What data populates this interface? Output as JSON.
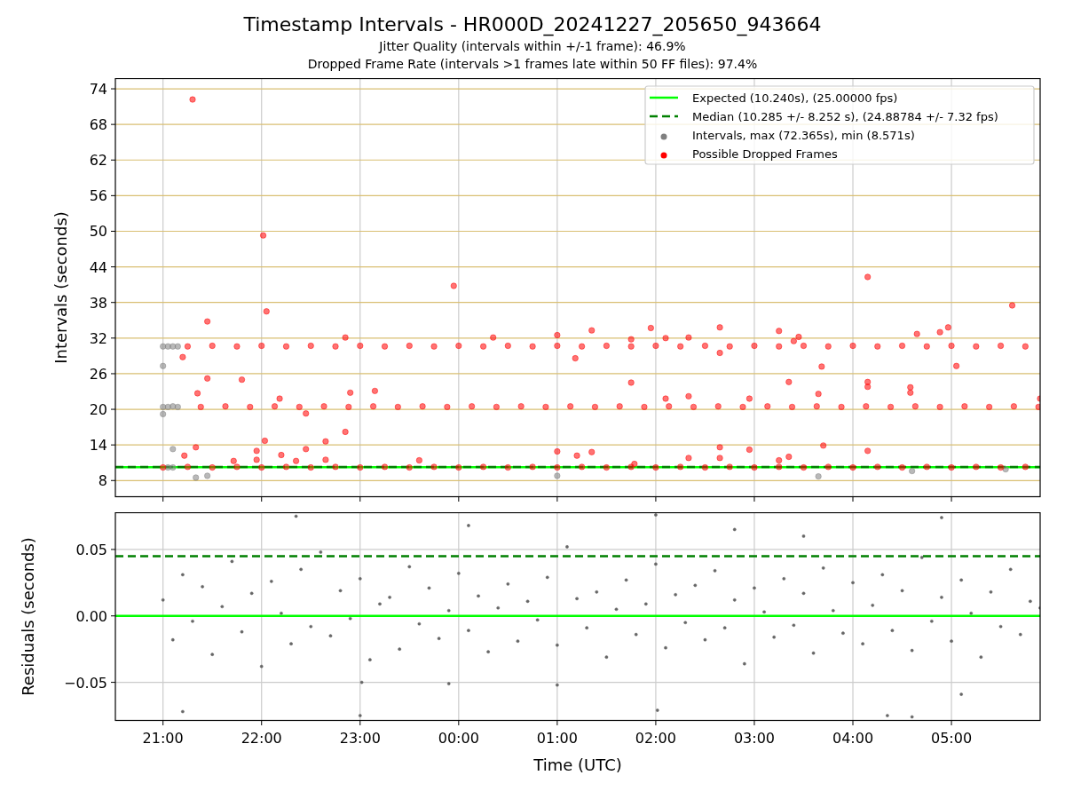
{
  "title": "Timestamp Intervals - HR000D_20241227_205650_943664",
  "subtitles": [
    "Jitter Quality (intervals within +/-1 frame): 46.9%",
    "Dropped Frame Rate (intervals >1 frames late within 50 FF files): 97.4%"
  ],
  "charts": [
    {
      "chart_data": {
        "type": "scatter",
        "ylabel": "Intervals (seconds)",
        "xlim": [
          "2024-12-27T20:31",
          "2024-12-28T05:54"
        ],
        "ylim": [
          5.2,
          75.8
        ],
        "yticks": [
          8,
          14,
          20,
          26,
          32,
          38,
          44,
          50,
          56,
          62,
          68,
          74
        ],
        "grid": true,
        "legend": true,
        "ref_lines": [
          {
            "label": "Expected (10.240s), (25.00000 fps)",
            "color": "#00ff00",
            "axis": "y",
            "value": 10.24
          },
          {
            "label": "Median (10.285 +/- 8.252 s), (24.88784 +/- 7.32 fps)",
            "color": "#008000",
            "axis": "y",
            "value": 10.285
          }
        ],
        "series": [
          {
            "name": "Intervals, max (72.365s), min (8.571s)",
            "color": "#808080",
            "x": [
              "2024-12-27T21:00",
              "2024-12-27T21:03",
              "2024-12-27T21:06",
              "2024-12-27T21:09",
              "2024-12-27T21:00",
              "2024-12-27T21:03",
              "2024-12-27T21:06",
              "2024-12-27T21:09",
              "2024-12-27T21:03",
              "2024-12-27T21:06",
              "2024-12-27T21:00",
              "2024-12-27T21:00",
              "2024-12-27T21:06",
              "2024-12-27T21:20",
              "2024-12-27T21:27",
              "2024-12-28T01:00",
              "2024-12-28T03:39",
              "2024-12-28T04:36",
              "2024-12-28T05:33"
            ],
            "values": [
              30.6,
              30.6,
              30.6,
              30.6,
              20.4,
              20.4,
              20.5,
              20.4,
              10.2,
              10.2,
              27.3,
              19.2,
              13.3,
              8.5,
              8.8,
              8.8,
              8.7,
              9.6,
              9.9
            ]
          },
          {
            "name": "Possible Dropped Frames",
            "color": "#ff0000",
            "x": [
              "2024-12-27T21:00",
              "2024-12-27T21:15",
              "2024-12-27T21:30",
              "2024-12-27T21:45",
              "2024-12-27T22:00",
              "2024-12-27T22:15",
              "2024-12-27T22:30",
              "2024-12-27T22:45",
              "2024-12-27T23:00",
              "2024-12-27T23:15",
              "2024-12-27T23:30",
              "2024-12-27T23:45",
              "2024-12-28T00:00",
              "2024-12-28T00:15",
              "2024-12-28T00:30",
              "2024-12-28T00:45",
              "2024-12-28T01:00",
              "2024-12-28T01:15",
              "2024-12-28T01:30",
              "2024-12-28T01:45",
              "2024-12-28T02:00",
              "2024-12-28T02:15",
              "2024-12-28T02:30",
              "2024-12-28T02:45",
              "2024-12-28T03:00",
              "2024-12-28T03:15",
              "2024-12-28T03:30",
              "2024-12-28T03:45",
              "2024-12-28T04:00",
              "2024-12-28T04:15",
              "2024-12-28T04:30",
              "2024-12-28T04:45",
              "2024-12-28T05:00",
              "2024-12-28T05:15",
              "2024-12-28T05:30",
              "2024-12-28T05:45",
              "2024-12-27T21:23",
              "2024-12-27T21:38",
              "2024-12-27T21:53",
              "2024-12-27T22:08",
              "2024-12-27T22:23",
              "2024-12-27T22:38",
              "2024-12-27T22:53",
              "2024-12-27T23:08",
              "2024-12-27T23:23",
              "2024-12-27T23:38",
              "2024-12-27T23:53",
              "2024-12-28T00:08",
              "2024-12-28T00:23",
              "2024-12-28T00:38",
              "2024-12-28T00:53",
              "2024-12-28T01:08",
              "2024-12-28T01:23",
              "2024-12-28T01:38",
              "2024-12-28T01:53",
              "2024-12-28T02:08",
              "2024-12-28T02:23",
              "2024-12-28T02:38",
              "2024-12-28T02:53",
              "2024-12-28T03:08",
              "2024-12-28T03:23",
              "2024-12-28T03:38",
              "2024-12-28T03:53",
              "2024-12-28T04:08",
              "2024-12-28T04:23",
              "2024-12-28T04:38",
              "2024-12-28T04:53",
              "2024-12-28T05:08",
              "2024-12-28T05:23",
              "2024-12-28T05:38",
              "2024-12-28T05:53",
              "2024-12-27T21:15",
              "2024-12-27T21:30",
              "2024-12-27T21:45",
              "2024-12-27T22:00",
              "2024-12-27T22:15",
              "2024-12-27T22:30",
              "2024-12-27T22:45",
              "2024-12-27T23:00",
              "2024-12-27T23:15",
              "2024-12-27T23:30",
              "2024-12-27T23:45",
              "2024-12-28T00:00",
              "2024-12-28T00:15",
              "2024-12-28T00:30",
              "2024-12-28T00:45",
              "2024-12-28T01:00",
              "2024-12-28T01:15",
              "2024-12-28T01:30",
              "2024-12-28T01:45",
              "2024-12-28T02:00",
              "2024-12-28T02:15",
              "2024-12-28T02:30",
              "2024-12-28T02:45",
              "2024-12-28T03:00",
              "2024-12-28T03:15",
              "2024-12-28T03:30",
              "2024-12-28T03:45",
              "2024-12-28T04:00",
              "2024-12-28T04:15",
              "2024-12-28T04:30",
              "2024-12-28T04:45",
              "2024-12-28T05:00",
              "2024-12-28T05:15",
              "2024-12-28T05:30",
              "2024-12-28T05:45",
              "2024-12-27T21:18",
              "2024-12-27T22:01",
              "2024-12-27T22:03",
              "2024-12-27T23:57",
              "2024-12-28T04:09",
              "2024-12-28T05:37",
              "2024-12-27T21:27",
              "2024-12-27T21:12",
              "2024-12-27T21:21",
              "2024-12-27T21:27",
              "2024-12-27T21:48",
              "2024-12-27T22:11",
              "2024-12-27T21:20",
              "2024-12-27T21:13",
              "2024-12-27T22:02",
              "2024-12-27T21:57",
              "2024-12-27T21:57",
              "2024-12-27T22:12",
              "2024-12-27T21:43",
              "2024-12-27T22:21",
              "2024-12-27T22:27",
              "2024-12-27T22:27",
              "2024-12-27T22:39",
              "2024-12-27T22:39",
              "2024-12-27T22:51",
              "2024-12-27T22:54",
              "2024-12-27T22:51",
              "2024-12-27T23:09",
              "2024-12-27T23:36",
              "2024-12-28T00:21",
              "2024-12-28T01:00",
              "2024-12-28T01:00",
              "2024-12-28T01:11",
              "2024-12-28T01:12",
              "2024-12-28T01:21",
              "2024-12-28T01:21",
              "2024-12-28T01:45",
              "2024-12-28T01:45",
              "2024-12-28T01:47",
              "2024-12-28T01:57",
              "2024-12-28T02:06",
              "2024-12-28T02:06",
              "2024-12-28T02:20",
              "2024-12-28T02:20",
              "2024-12-28T02:20",
              "2024-12-28T02:39",
              "2024-12-28T02:39",
              "2024-12-28T02:39",
              "2024-12-28T02:39",
              "2024-12-28T02:57",
              "2024-12-28T02:57",
              "2024-12-28T03:15",
              "2024-12-28T03:15",
              "2024-12-28T03:21",
              "2024-12-28T03:24",
              "2024-12-28T03:27",
              "2024-12-28T03:21",
              "2024-12-28T03:41",
              "2024-12-28T03:42",
              "2024-12-28T03:39",
              "2024-12-28T04:09",
              "2024-12-28T04:09",
              "2024-12-28T04:09",
              "2024-12-28T04:35",
              "2024-12-28T04:35",
              "2024-12-28T04:39",
              "2024-12-28T04:53",
              "2024-12-28T04:58",
              "2024-12-28T05:03",
              "2024-12-28T05:54"
            ],
            "values": [
              10.2,
              10.3,
              10.2,
              10.3,
              10.2,
              10.3,
              10.2,
              10.3,
              10.2,
              10.3,
              10.2,
              10.3,
              10.2,
              10.3,
              10.2,
              10.3,
              10.2,
              10.3,
              10.2,
              10.3,
              10.2,
              10.3,
              10.2,
              10.3,
              10.2,
              10.3,
              10.2,
              10.3,
              10.2,
              10.3,
              10.2,
              10.3,
              10.2,
              10.3,
              10.2,
              10.3,
              20.4,
              20.5,
              20.4,
              20.5,
              20.4,
              20.5,
              20.4,
              20.5,
              20.4,
              20.5,
              20.4,
              20.5,
              20.4,
              20.5,
              20.4,
              20.5,
              20.4,
              20.5,
              20.4,
              20.5,
              20.4,
              20.5,
              20.4,
              20.5,
              20.4,
              20.5,
              20.4,
              20.5,
              20.4,
              20.5,
              20.4,
              20.5,
              20.4,
              20.5,
              20.4,
              30.6,
              30.7,
              30.6,
              30.7,
              30.6,
              30.7,
              30.6,
              30.7,
              30.6,
              30.7,
              30.6,
              30.7,
              30.6,
              30.7,
              30.6,
              30.7,
              30.6,
              30.7,
              30.6,
              30.7,
              30.6,
              30.7,
              30.6,
              30.7,
              30.6,
              30.7,
              30.6,
              30.7,
              30.6,
              30.7,
              30.6,
              30.7,
              30.6,
              30.7,
              30.6,
              72.2,
              49.3,
              36.5,
              40.8,
              42.3,
              37.5,
              34.8,
              28.8,
              22.7,
              25.2,
              25.0,
              21.8,
              13.6,
              12.2,
              14.7,
              13.0,
              11.5,
              12.3,
              11.3,
              11.3,
              13.3,
              19.3,
              14.6,
              11.5,
              16.2,
              22.8,
              32.1,
              23.1,
              11.4,
              32.1,
              32.5,
              12.9,
              28.6,
              12.2,
              33.3,
              12.8,
              24.5,
              31.8,
              10.8,
              33.7,
              32.0,
              21.8,
              22.2,
              11.8,
              32.1,
              33.8,
              29.5,
              13.6,
              11.8,
              21.8,
              13.2,
              33.2,
              11.4,
              24.6,
              31.5,
              32.2,
              12.0,
              27.2,
              13.9,
              22.6,
              24.6,
              23.8,
              13.0,
              23.7,
              22.8,
              32.7,
              33.0,
              33.8,
              27.3,
              21.8
            ]
          }
        ]
      }
    },
    {
      "chart_data": {
        "type": "scatter",
        "xlabel": "Time (UTC)",
        "ylabel": "Residuals (seconds)",
        "xlim": [
          "2024-12-27T20:31",
          "2024-12-28T05:54"
        ],
        "ylim": [
          -0.079,
          0.078
        ],
        "xticks": [
          {
            "value": "2024-12-27T21:00",
            "label": "21:00"
          },
          {
            "value": "2024-12-27T22:00",
            "label": "22:00"
          },
          {
            "value": "2024-12-27T23:00",
            "label": "23:00"
          },
          {
            "value": "2024-12-28T00:00",
            "label": "00:00"
          },
          {
            "value": "2024-12-28T01:00",
            "label": "01:00"
          },
          {
            "value": "2024-12-28T02:00",
            "label": "02:00"
          },
          {
            "value": "2024-12-28T03:00",
            "label": "03:00"
          },
          {
            "value": "2024-12-28T04:00",
            "label": "04:00"
          },
          {
            "value": "2024-12-28T05:00",
            "label": "05:00"
          }
        ],
        "yticks": [
          {
            "value": -0.05,
            "label": "−0.05"
          },
          {
            "value": 0,
            "label": "0.00"
          },
          {
            "value": 0.05,
            "label": "0.05"
          }
        ],
        "grid": true,
        "ref_lines": [
          {
            "color": "#00ff00",
            "axis": "y",
            "value": 0
          },
          {
            "color": "#008000",
            "axis": "y",
            "value": 0.045
          }
        ],
        "series": [
          {
            "color": "#666666",
            "x": [
              "2024-12-27T21:00",
              "2024-12-27T21:06",
              "2024-12-27T21:12",
              "2024-12-27T21:18",
              "2024-12-27T21:24",
              "2024-12-27T21:30",
              "2024-12-27T21:36",
              "2024-12-27T21:42",
              "2024-12-27T21:48",
              "2024-12-27T21:54",
              "2024-12-27T22:00",
              "2024-12-27T22:06",
              "2024-12-27T22:12",
              "2024-12-27T22:18",
              "2024-12-27T22:24",
              "2024-12-27T22:30",
              "2024-12-27T22:36",
              "2024-12-27T22:42",
              "2024-12-27T22:48",
              "2024-12-27T22:54",
              "2024-12-27T23:00",
              "2024-12-27T23:06",
              "2024-12-27T23:12",
              "2024-12-27T23:18",
              "2024-12-27T23:24",
              "2024-12-27T23:30",
              "2024-12-27T23:36",
              "2024-12-27T23:42",
              "2024-12-27T23:48",
              "2024-12-27T23:54",
              "2024-12-28T00:00",
              "2024-12-28T00:06",
              "2024-12-28T00:12",
              "2024-12-28T00:18",
              "2024-12-28T00:24",
              "2024-12-28T00:30",
              "2024-12-28T00:36",
              "2024-12-28T00:42",
              "2024-12-28T00:48",
              "2024-12-28T00:54",
              "2024-12-28T01:00",
              "2024-12-28T01:06",
              "2024-12-28T01:12",
              "2024-12-28T01:18",
              "2024-12-28T01:24",
              "2024-12-28T01:30",
              "2024-12-28T01:36",
              "2024-12-28T01:42",
              "2024-12-28T01:48",
              "2024-12-28T01:54",
              "2024-12-28T02:00",
              "2024-12-28T02:06",
              "2024-12-28T02:12",
              "2024-12-28T02:18",
              "2024-12-28T02:24",
              "2024-12-28T02:30",
              "2024-12-28T02:36",
              "2024-12-28T02:42",
              "2024-12-28T02:48",
              "2024-12-28T02:54",
              "2024-12-28T03:00",
              "2024-12-28T03:06",
              "2024-12-28T03:12",
              "2024-12-28T03:18",
              "2024-12-28T03:24",
              "2024-12-28T03:30",
              "2024-12-28T03:36",
              "2024-12-28T03:42",
              "2024-12-28T03:48",
              "2024-12-28T03:54",
              "2024-12-28T04:00",
              "2024-12-28T04:06",
              "2024-12-28T04:12",
              "2024-12-28T04:18",
              "2024-12-28T04:24",
              "2024-12-28T04:30",
              "2024-12-28T04:36",
              "2024-12-28T04:42",
              "2024-12-28T04:48",
              "2024-12-28T04:54",
              "2024-12-28T05:00",
              "2024-12-28T05:06",
              "2024-12-28T05:12",
              "2024-12-28T05:18",
              "2024-12-28T05:24",
              "2024-12-28T05:30",
              "2024-12-28T05:36",
              "2024-12-28T05:42",
              "2024-12-28T05:48",
              "2024-12-28T05:54",
              "2024-12-27T21:12",
              "2024-12-27T22:21",
              "2024-12-27T23:00",
              "2024-12-27T23:01",
              "2024-12-27T23:54",
              "2024-12-28T01:00",
              "2024-12-28T02:00",
              "2024-12-28T02:01",
              "2024-12-28T04:21",
              "2024-12-28T04:54",
              "2024-12-28T04:36",
              "2024-12-28T00:06",
              "2024-12-28T02:48",
              "2024-12-28T03:30",
              "2024-12-28T05:06"
            ],
            "values": [
              0.012,
              -0.018,
              0.031,
              -0.004,
              0.022,
              -0.029,
              0.007,
              0.041,
              -0.012,
              0.017,
              -0.038,
              0.026,
              0.002,
              -0.021,
              0.035,
              -0.008,
              0.048,
              -0.015,
              0.019,
              -0.002,
              0.028,
              -0.033,
              0.009,
              0.014,
              -0.025,
              0.037,
              -0.006,
              0.021,
              -0.017,
              0.004,
              0.032,
              -0.011,
              0.015,
              -0.027,
              0.006,
              0.024,
              -0.019,
              0.011,
              -0.003,
              0.029,
              -0.022,
              0.052,
              0.013,
              -0.009,
              0.018,
              -0.031,
              0.005,
              0.027,
              -0.014,
              0.009,
              0.039,
              -0.024,
              0.016,
              -0.005,
              0.023,
              -0.018,
              0.034,
              -0.009,
              0.012,
              -0.036,
              0.021,
              0.003,
              -0.016,
              0.028,
              -0.007,
              0.017,
              -0.028,
              0.036,
              0.004,
              -0.013,
              0.025,
              -0.021,
              0.008,
              0.031,
              -0.011,
              0.019,
              -0.026,
              0.044,
              -0.004,
              0.014,
              -0.019,
              0.027,
              0.002,
              -0.031,
              0.018,
              -0.008,
              0.035,
              -0.014,
              0.011,
              0.006,
              -0.072,
              0.075,
              -0.075,
              -0.05,
              -0.051,
              -0.052,
              0.076,
              -0.071,
              -0.075,
              0.074,
              -0.076,
              0.068,
              0.065,
              0.06,
              -0.059
            ]
          }
        ]
      }
    }
  ]
}
